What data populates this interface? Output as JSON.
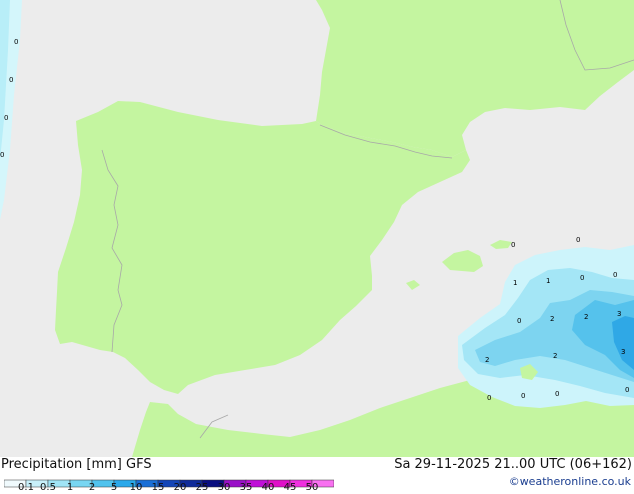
{
  "header": {
    "left_title": "Precipitation [mm]  GFS",
    "right_title": "Sa 29-11-2025 21..00 UTC (06+162)",
    "credit": "©weatheronline.co.uk"
  },
  "legend": {
    "ticks": [
      "0.1",
      "0.5",
      "1",
      "2",
      "5",
      "10",
      "15",
      "20",
      "25",
      "30",
      "35",
      "40",
      "45",
      "50"
    ],
    "colors": [
      "#f0fafd",
      "#c8f0fa",
      "#a0e4f6",
      "#78d6f2",
      "#50c3ee",
      "#2aa8ea",
      "#1a6fd6",
      "#1446b8",
      "#102c9a",
      "#0a0f80",
      "#9a10c8",
      "#c010d8",
      "#e010c8",
      "#f030e0",
      "#f870f0"
    ]
  },
  "map": {
    "colors": {
      "sea": "#ececec",
      "land": "#c4f5a0",
      "border": "#a8a8a8"
    },
    "contour_labels": [
      "0",
      "0",
      "0",
      "0",
      "0",
      "0",
      "1",
      "1",
      "0",
      "0",
      "0",
      "2",
      "2",
      "3",
      "2",
      "2",
      "3",
      "0",
      "0",
      "0",
      "0"
    ]
  }
}
